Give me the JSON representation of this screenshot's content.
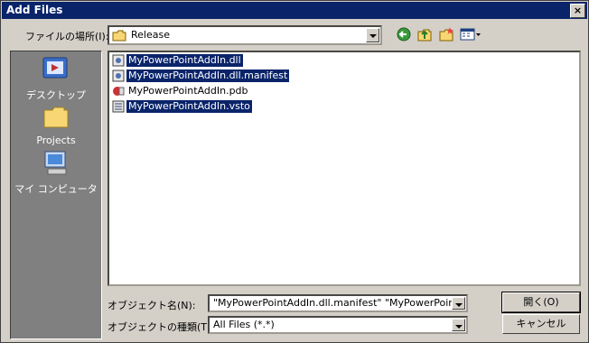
{
  "window": {
    "title": "Add Files",
    "close": "×"
  },
  "lookin": {
    "label": "ファイルの場所(I):",
    "value": "Release"
  },
  "places": [
    {
      "label": "デスクトップ",
      "icon": "desktop-icon"
    },
    {
      "label": "Projects",
      "icon": "folder-icon"
    },
    {
      "label": "マイ コンピュータ",
      "icon": "my-computer-icon"
    }
  ],
  "files": [
    {
      "name": "MyPowerPointAddIn.dll",
      "icon": "dll-icon",
      "selected": true
    },
    {
      "name": "MyPowerPointAddIn.dll.manifest",
      "icon": "manifest-icon",
      "selected": true
    },
    {
      "name": "MyPowerPointAddIn.pdb",
      "icon": "pdb-icon",
      "selected": false
    },
    {
      "name": "MyPowerPointAddIn.vsto",
      "icon": "vsto-icon",
      "selected": true
    }
  ],
  "filename": {
    "label": "オブジェクト名(N):",
    "value": "\"MyPowerPointAddIn.dll.manifest\" \"MyPowerPointAc"
  },
  "filetype": {
    "label": "オブジェクトの種類(T):",
    "value": "All Files (*.*)"
  },
  "buttons": {
    "open": "開く(O)",
    "cancel": "キャンセル"
  },
  "colors": {
    "titlebar": "#0a246a",
    "selection": "#0a246a",
    "face": "#d4d0c8"
  }
}
